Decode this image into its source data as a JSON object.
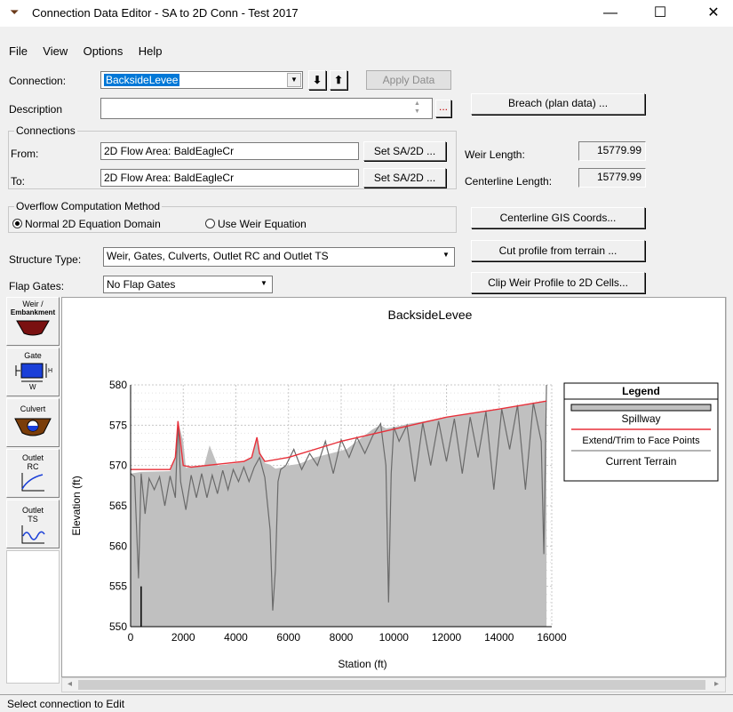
{
  "window": {
    "title": "Connection Data Editor - SA to 2D Conn - Test 2017",
    "minimize": "—",
    "maximize": "☐",
    "close": "✕"
  },
  "menu": [
    "File",
    "View",
    "Options",
    "Help"
  ],
  "connection": {
    "label": "Connection:",
    "value": "BacksideLevee",
    "apply_label": "Apply Data"
  },
  "description": {
    "label": "Description",
    "value": "",
    "more": "..."
  },
  "breach_button": "Breach (plan data) ...",
  "connections_group": {
    "title": "Connections",
    "from_label": "From:",
    "from_value": "2D Flow Area: BaldEagleCr",
    "to_label": "To:",
    "to_value": "2D Flow Area: BaldEagleCr",
    "set_label": "Set SA/2D ..."
  },
  "lengths": {
    "weir_label": "Weir Length:",
    "weir_value": "15779.99",
    "centerline_label": "Centerline Length:",
    "centerline_value": "15779.99"
  },
  "overflow": {
    "title": "Overflow Computation Method",
    "option1": "Normal 2D Equation Domain",
    "option2": "Use Weir Equation",
    "selected": "Normal 2D Equation Domain"
  },
  "buttons": {
    "gis": "Centerline GIS Coords...",
    "cut": "Cut profile from terrain ...",
    "clip": "Clip Weir Profile to 2D Cells..."
  },
  "structure_type": {
    "label": "Structure Type:",
    "value": "Weir, Gates, Culverts, Outlet RC and Outlet TS"
  },
  "flap_gates": {
    "label": "Flap Gates:",
    "value": "No Flap Gates"
  },
  "toolbox": {
    "weir": [
      "Weir /",
      "Embankment"
    ],
    "gate": "Gate",
    "culvert": "Culvert",
    "outlet_rc": [
      "Outlet",
      "RC"
    ],
    "outlet_ts": [
      "Outlet",
      "TS"
    ]
  },
  "status": "Select connection to Edit",
  "colors": {
    "spillway_fill": "#c0c0c0",
    "extend_line": "#e8303a",
    "terrain_line": "#6a6a6a"
  },
  "chart_data": {
    "type": "area",
    "title": "BacksideLevee",
    "xlabel": "Station (ft)",
    "ylabel": "Elevation (ft)",
    "xlim": [
      0,
      16000
    ],
    "ylim": [
      550,
      580
    ],
    "xticks": [
      "0",
      "2000",
      "4000",
      "6000",
      "8000",
      "10000",
      "12000",
      "14000",
      "16000"
    ],
    "yticks": [
      "550",
      "555",
      "560",
      "565",
      "570",
      "575",
      "580"
    ],
    "grid": true,
    "legend": {
      "title": "Legend",
      "position": "right",
      "entries": [
        "Spillway",
        "Extend/Trim to Face Points",
        "Current Terrain"
      ]
    },
    "series": [
      {
        "name": "Spillway",
        "x": [
          0,
          400,
          1500,
          1700,
          1800,
          2000,
          2100,
          2300,
          2800,
          3000,
          3300,
          4300,
          4600,
          4800,
          4900,
          5100,
          5300,
          5500,
          5800,
          6000,
          6400,
          7000,
          7600,
          8200,
          8800,
          9200,
          9500,
          9700,
          9900,
          10200,
          10600,
          11000,
          11500,
          12000,
          12500,
          13000,
          13500,
          14000,
          14500,
          15000,
          15500,
          15800
        ],
        "y": [
          569,
          569.2,
          569.3,
          571,
          575.5,
          573,
          569.7,
          569.8,
          570,
          572.5,
          570,
          570.4,
          571,
          573.5,
          571.8,
          570.3,
          570.1,
          569.6,
          569.8,
          570,
          570.2,
          571,
          571.5,
          572,
          573.5,
          574.5,
          575,
          574.6,
          574.7,
          574.9,
          575.2,
          575.4,
          575.7,
          576,
          576.2,
          576.5,
          576.8,
          577,
          577.2,
          577.5,
          577.8,
          578
        ]
      },
      {
        "name": "Extend/Trim to Face Points",
        "x": [
          0,
          1500,
          1700,
          1800,
          2000,
          2300,
          4300,
          4600,
          4800,
          4900,
          5100,
          6000,
          8000,
          10000,
          12000,
          14000,
          15800
        ],
        "y": [
          569.5,
          569.5,
          571,
          575.5,
          570,
          569.8,
          570.5,
          571,
          573.5,
          571.5,
          570.5,
          571,
          573,
          574.5,
          576,
          577,
          578
        ]
      },
      {
        "name": "Current Terrain",
        "x": [
          0,
          150,
          300,
          400,
          550,
          700,
          900,
          1100,
          1300,
          1500,
          1700,
          1800,
          1900,
          2100,
          2300,
          2500,
          2700,
          2900,
          3100,
          3300,
          3500,
          3700,
          3900,
          4100,
          4300,
          4500,
          4700,
          4900,
          5100,
          5300,
          5400,
          5500,
          5600,
          5700,
          5900,
          6200,
          6500,
          6800,
          7100,
          7400,
          7700,
          8000,
          8300,
          8600,
          8900,
          9200,
          9500,
          9700,
          9800,
          9900,
          10000,
          10200,
          10500,
          10800,
          11100,
          11400,
          11700,
          12000,
          12300,
          12600,
          12900,
          13200,
          13500,
          13800,
          14100,
          14400,
          14700,
          15000,
          15300,
          15600,
          15700,
          15800
        ],
        "y": [
          569,
          568.6,
          556,
          569,
          564,
          568.4,
          567,
          568.6,
          565,
          568.7,
          566,
          575.5,
          568,
          564.5,
          568.8,
          566,
          569,
          566,
          568.8,
          566.5,
          569.4,
          567,
          569.5,
          568,
          569.8,
          568,
          569.8,
          571,
          568.5,
          562,
          552,
          557,
          568,
          569.5,
          570,
          572,
          569.5,
          571.5,
          570,
          573,
          569,
          573.2,
          571,
          573.5,
          571.5,
          573.7,
          575.2,
          570,
          553,
          569,
          574.8,
          573,
          575,
          568,
          575.3,
          570,
          575.5,
          570.5,
          575.8,
          569,
          576,
          571,
          576.7,
          567,
          577,
          572,
          577.5,
          567,
          577.8,
          573,
          559,
          580
        ]
      }
    ]
  }
}
